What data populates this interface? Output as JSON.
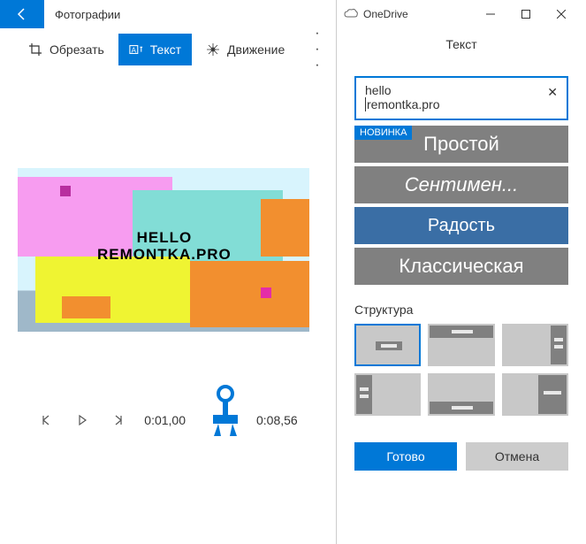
{
  "left": {
    "app_title": "Фотографии",
    "toolbar": {
      "crop": "Обрезать",
      "text": "Текст",
      "motion": "Движение"
    },
    "canvas_text_line1": "HELLO",
    "canvas_text_line2": "REMONTKA.PRO",
    "playback": {
      "current": "0:01,00",
      "total": "0:08,56"
    }
  },
  "right": {
    "window_title": "OneDrive",
    "panel_title": "Текст",
    "input_line1": "hello",
    "input_line2": "remontka.pro",
    "badge_new": "НОВИНКА",
    "styles": {
      "simple": "Простой",
      "sentimental": "Сентимен...",
      "joy": "Радость",
      "classic": "Классическая"
    },
    "structure_label": "Структура",
    "actions": {
      "done": "Готово",
      "cancel": "Отмена"
    }
  }
}
